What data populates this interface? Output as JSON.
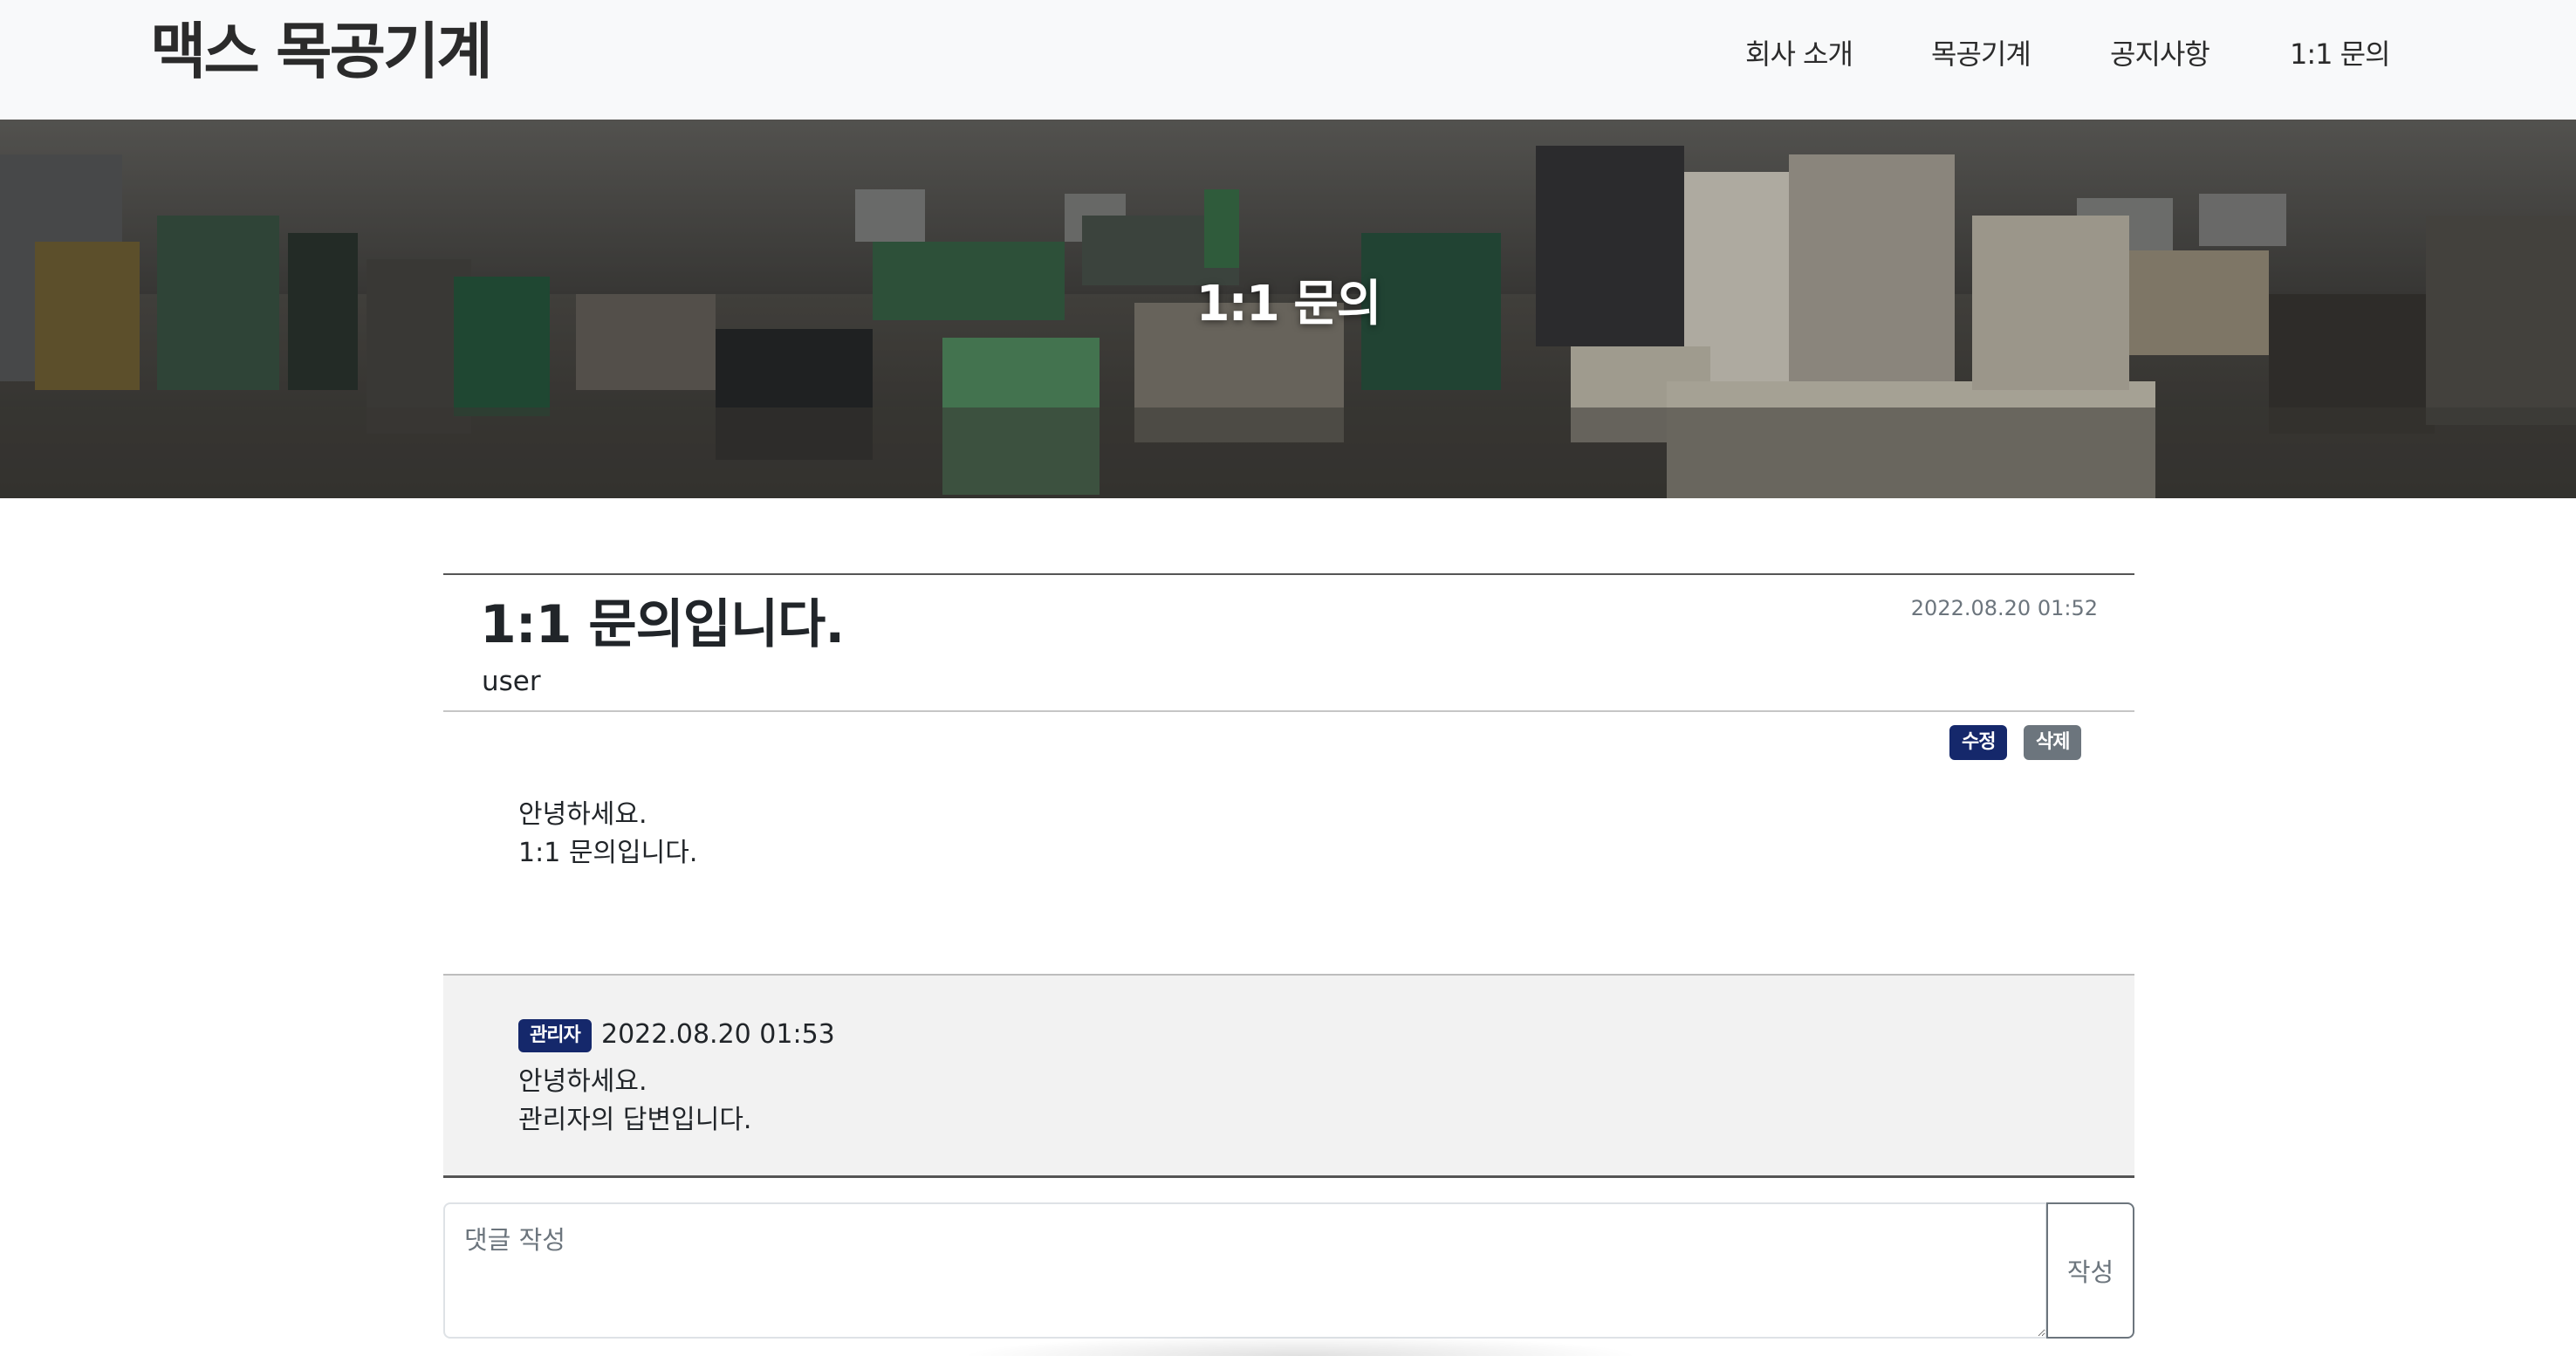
{
  "header": {
    "brand": "맥스 목공기계",
    "nav": [
      "회사 소개",
      "목공기계",
      "공지사항",
      "1:1 문의"
    ]
  },
  "hero": {
    "title": "1:1 문의"
  },
  "post": {
    "title": "1:1 문의입니다.",
    "author": "user",
    "date": "2022.08.20 01:52",
    "edit_label": "수정",
    "delete_label": "삭제",
    "body_lines": [
      "안녕하세요.",
      "1:1 문의입니다."
    ]
  },
  "reply": {
    "badge": "관리자",
    "date": "2022.08.20 01:53",
    "body_lines": [
      "안녕하세요.",
      "관리자의 답변입니다."
    ]
  },
  "comment_form": {
    "placeholder": "댓글 작성",
    "value": "",
    "submit_label": "작성"
  },
  "colors": {
    "header_bg": "#f8f9fa",
    "primary_badge": "#15286b",
    "secondary_badge": "#6c757d",
    "reply_bg": "#f2f2f2"
  }
}
